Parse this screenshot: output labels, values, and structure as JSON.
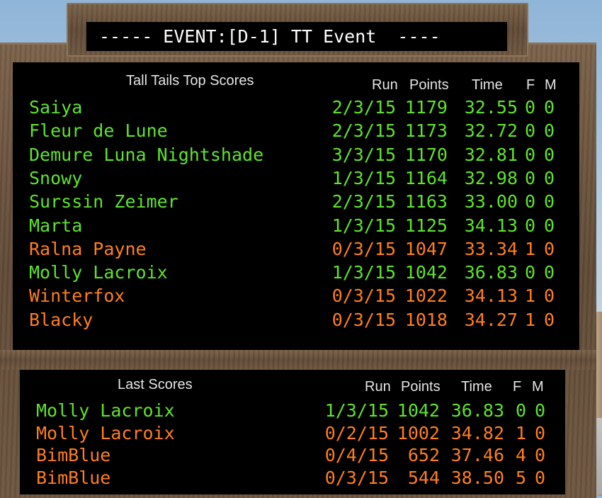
{
  "event_title": "----- EVENT:[D-1] TT Event  ----",
  "top_board": {
    "heading": "Tall Tails Top Scores",
    "columns": {
      "run": "Run",
      "points": "Points",
      "time": "Time",
      "f": "F",
      "m": "M"
    },
    "rows": [
      {
        "name": "Saiya",
        "run": "2/3/15",
        "points": "1179",
        "time": "32.55",
        "f": "0",
        "m": "0",
        "status": "ok"
      },
      {
        "name": "Fleur de Lune",
        "run": "2/3/15",
        "points": "1173",
        "time": "32.72",
        "f": "0",
        "m": "0",
        "status": "ok"
      },
      {
        "name": "Demure Luna Nightshade",
        "run": "3/3/15",
        "points": "1170",
        "time": "32.81",
        "f": "0",
        "m": "0",
        "status": "ok"
      },
      {
        "name": "Snowy",
        "run": "1/3/15",
        "points": "1164",
        "time": "32.98",
        "f": "0",
        "m": "0",
        "status": "ok"
      },
      {
        "name": "Surssin Zeimer",
        "run": "2/3/15",
        "points": "1163",
        "time": "33.00",
        "f": "0",
        "m": "0",
        "status": "ok"
      },
      {
        "name": "Marta",
        "run": "1/3/15",
        "points": "1125",
        "time": "34.13",
        "f": "0",
        "m": "0",
        "status": "ok"
      },
      {
        "name": "Ralna Payne",
        "run": "0/3/15",
        "points": "1047",
        "time": "33.34",
        "f": "1",
        "m": "0",
        "status": "fault"
      },
      {
        "name": "Molly Lacroix",
        "run": "1/3/15",
        "points": "1042",
        "time": "36.83",
        "f": "0",
        "m": "0",
        "status": "ok"
      },
      {
        "name": "Winterfox",
        "run": "0/3/15",
        "points": "1022",
        "time": "34.13",
        "f": "1",
        "m": "0",
        "status": "fault"
      },
      {
        "name": "Blacky",
        "run": "0/3/15",
        "points": "1018",
        "time": "34.27",
        "f": "1",
        "m": "0",
        "status": "fault"
      }
    ]
  },
  "last_board": {
    "heading": "Last Scores",
    "columns": {
      "run": "Run",
      "points": "Points",
      "time": "Time",
      "f": "F",
      "m": "M"
    },
    "rows": [
      {
        "name": "Molly Lacroix",
        "run": "1/3/15",
        "points": "1042",
        "time": "36.83",
        "f": "0",
        "m": "0",
        "status": "ok"
      },
      {
        "name": "Molly Lacroix",
        "run": "0/2/15",
        "points": "1002",
        "time": "34.82",
        "f": "1",
        "m": "0",
        "status": "fault"
      },
      {
        "name": "BimBlue",
        "run": "0/4/15",
        "points": "652",
        "time": "37.46",
        "f": "4",
        "m": "0",
        "status": "fault"
      },
      {
        "name": "BimBlue",
        "run": "0/3/15",
        "points": "544",
        "time": "38.50",
        "f": "5",
        "m": "0",
        "status": "fault"
      }
    ]
  },
  "colors": {
    "ok": "#5fe42b",
    "fault": "#ff7f1f",
    "screen": "#000000",
    "wood": "#6d563f"
  }
}
